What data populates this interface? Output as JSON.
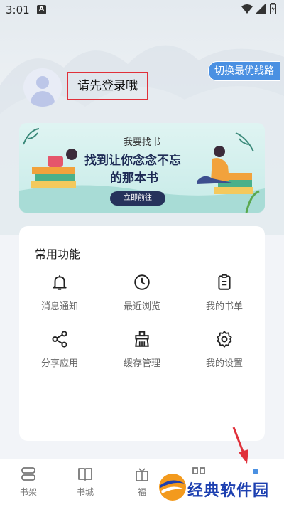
{
  "status_bar": {
    "time": "3:01",
    "ime_indicator": "A"
  },
  "header": {
    "switch_route_label": "切换最优线路",
    "login_prompt": "请先登录哦"
  },
  "banner": {
    "caption": "我要找书",
    "headline_line1": "找到让你念念不忘",
    "headline_line2": "的那本书",
    "button_label": "立即前往"
  },
  "functions": {
    "title": "常用功能",
    "items": [
      {
        "label": "消息通知",
        "icon": "bell-icon"
      },
      {
        "label": "最近浏览",
        "icon": "clock-icon"
      },
      {
        "label": "我的书单",
        "icon": "clipboard-icon"
      },
      {
        "label": "分享应用",
        "icon": "share-icon"
      },
      {
        "label": "缓存管理",
        "icon": "broom-icon"
      },
      {
        "label": "我的设置",
        "icon": "settings-icon"
      }
    ]
  },
  "tabbar": {
    "tabs": [
      {
        "label": "书架",
        "icon": "bookshelf-icon"
      },
      {
        "label": "书城",
        "icon": "book-open-icon"
      },
      {
        "label": "福",
        "icon": "gift-icon"
      },
      {
        "label": "",
        "icon": "grid-icon"
      },
      {
        "label": "",
        "icon": "profile-icon"
      }
    ]
  },
  "watermark": {
    "text": "经典软件园"
  },
  "colors": {
    "accent": "#4a90e2",
    "highlight_box": "#e0303a",
    "annotation_arrow": "#e0303a"
  }
}
